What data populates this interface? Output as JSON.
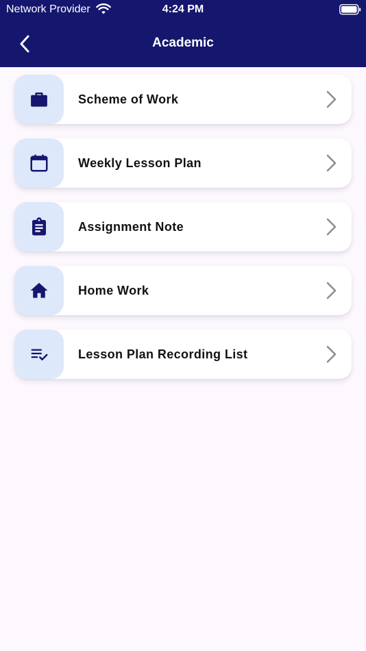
{
  "status_bar": {
    "carrier": "Network Provider",
    "time": "4:24 PM",
    "wifi_icon": "wifi-icon",
    "battery_icon": "battery-full-icon"
  },
  "nav": {
    "title": "Academic",
    "back_icon": "chevron-left-icon"
  },
  "colors": {
    "header_bg": "#15166e",
    "icon_tint": "#15166e",
    "icon_box_bg": "#dde8fb",
    "page_bg": "#fdf8fd",
    "chevron": "#8e8e8e"
  },
  "menu": {
    "items": [
      {
        "label": "Scheme of Work",
        "icon": "briefcase-icon"
      },
      {
        "label": "Weekly Lesson Plan",
        "icon": "calendar-icon"
      },
      {
        "label": "Assignment Note",
        "icon": "clipboard-icon"
      },
      {
        "label": "Home Work",
        "icon": "home-icon"
      },
      {
        "label": "Lesson Plan Recording List",
        "icon": "checklist-icon"
      }
    ]
  }
}
